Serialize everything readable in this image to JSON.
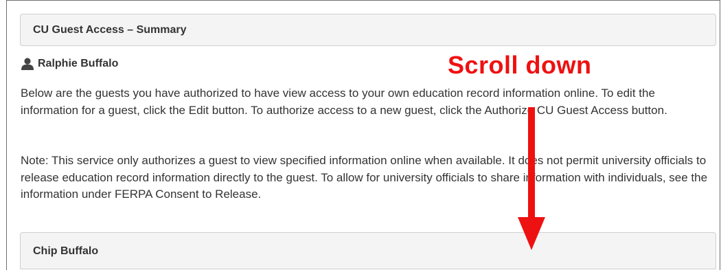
{
  "summary_panel": {
    "title": "CU Guest Access – Summary"
  },
  "user": {
    "icon": "user-icon",
    "name": "Ralphie Buffalo"
  },
  "intro_text": "Below are the guests you have authorized to have view access to your own education record information online. To edit the information for a guest, click the Edit button. To authorize access to a new guest, click the Authorize CU Guest Access button.",
  "note_text": "Note: This service only authorizes a guest to view specified information online when available. It does not permit university officials to release education record information directly to the guest. To allow for university officials to share information with individuals, see the information under FERPA Consent to Release.",
  "guest_panel": {
    "name": "Chip Buffalo"
  },
  "annotation": {
    "label": "Scroll down",
    "icon": "arrow-down-icon",
    "color": "#ee1111"
  }
}
